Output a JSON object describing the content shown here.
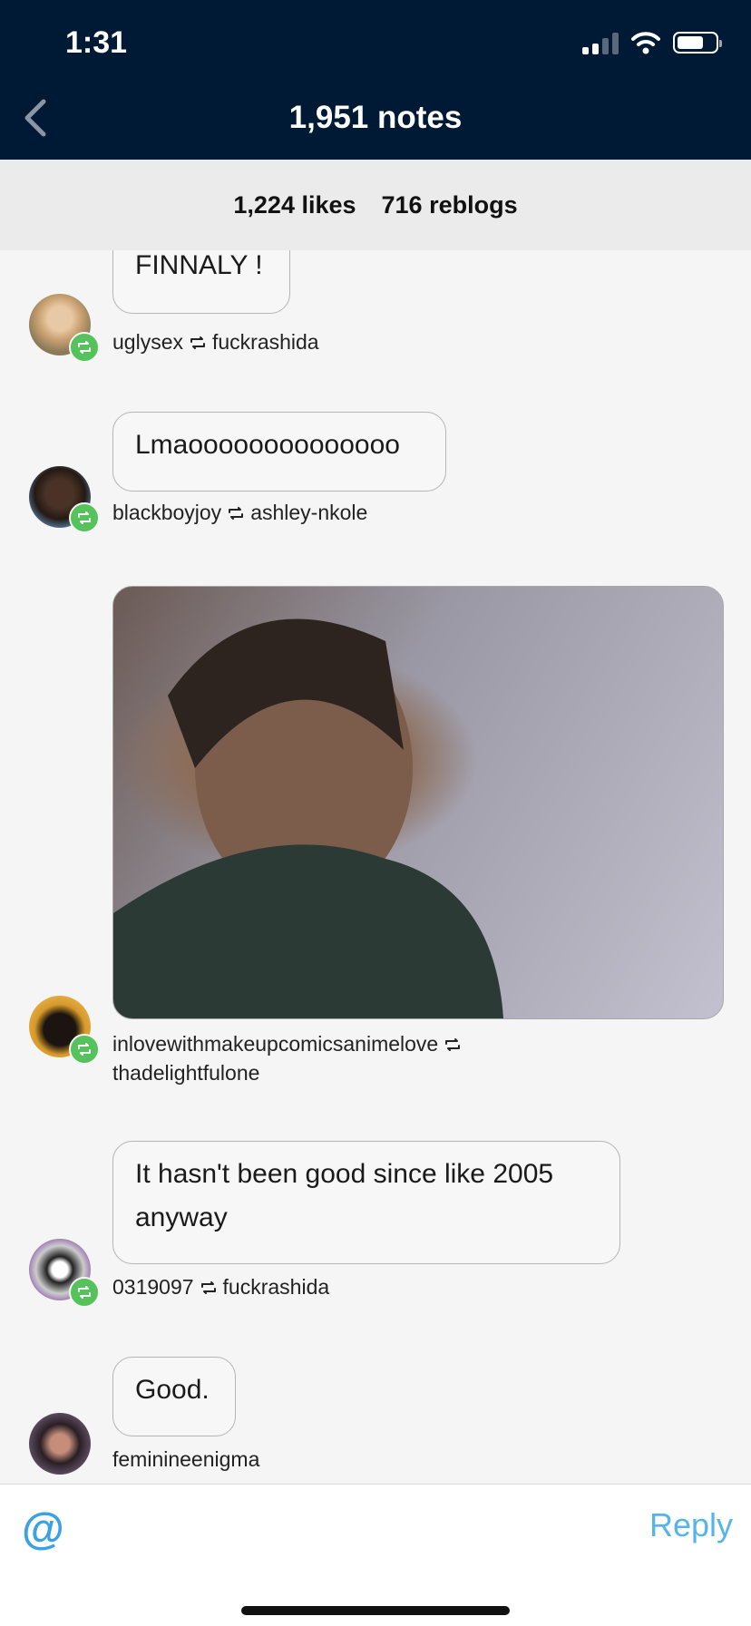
{
  "status_bar": {
    "time": "1:31"
  },
  "header": {
    "title": "1,951 notes"
  },
  "counts": {
    "likes": "1,224 likes",
    "reblogs": "716 reblogs"
  },
  "notes": [
    {
      "comment": "FINNALY !",
      "user": "uglysex",
      "reblogged_from": "fuckrashida"
    },
    {
      "comment": "Lmaoooooooooooooo",
      "user": "blackboyjoy",
      "reblogged_from": "ashley-nkole"
    },
    {
      "comment": "",
      "user": "inlovewithmakeupcomicsanimelove",
      "reblogged_from": "thadelightfulone"
    },
    {
      "comment": "It hasn't been good since like 2005 anyway",
      "user": "0319097",
      "reblogged_from": "fuckrashida"
    },
    {
      "comment": "Good.",
      "user": "feminineenigma",
      "reblogged_from": ""
    }
  ],
  "composer": {
    "mention_icon": "@",
    "reply_label": "Reply"
  },
  "colors": {
    "header_bg": "#001935",
    "reblog_badge": "#56c25b",
    "accent": "#56b4ea"
  }
}
